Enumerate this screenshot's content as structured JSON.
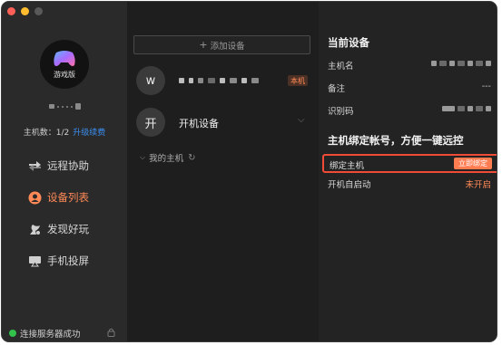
{
  "sidebar": {
    "avatar_label": "游戏版",
    "host_count_label": "主机数：1/2",
    "upgrade_link": "升级续费",
    "nav": [
      {
        "label": "远程协助",
        "icon": "remote-assist-icon",
        "active": false
      },
      {
        "label": "设备列表",
        "icon": "device-list-icon",
        "active": true
      },
      {
        "label": "发现好玩",
        "icon": "discover-icon",
        "active": false
      },
      {
        "label": "手机投屏",
        "icon": "screen-cast-icon",
        "active": false
      }
    ],
    "connection_status": "连接服务器成功"
  },
  "devices": {
    "add_button": "添加设备",
    "list": [
      {
        "avatar": "w",
        "name_masked": true,
        "badge": "本机"
      },
      {
        "avatar": "开",
        "name": "开机设备"
      }
    ],
    "group_label": "我的主机"
  },
  "current_device": {
    "title": "当前设备",
    "hostname_label": "主机名",
    "note_label": "备注",
    "note_value": "---",
    "id_label": "识别码"
  },
  "binding": {
    "title": "主机绑定帐号，方便一键远控",
    "bind_label": "绑定主机",
    "bind_button": "立即绑定",
    "autostart_label": "开机自启动",
    "autostart_value": "未开启"
  },
  "colors": {
    "accent": "#ff8a57",
    "link": "#3b8ff0",
    "highlight_border": "#ef4b36",
    "status_ok": "#32c14b"
  }
}
